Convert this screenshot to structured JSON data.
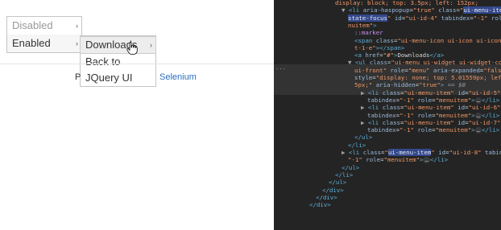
{
  "page": {
    "root_menu": {
      "items": [
        {
          "label": "Disabled",
          "state": "disabled"
        },
        {
          "label": "Enabled",
          "state": "active"
        }
      ]
    },
    "sub_menu": {
      "items": [
        {
          "label": "Downloads",
          "state": "focused"
        },
        {
          "label": "Back to"
        },
        {
          "label": "JQuery UI"
        }
      ]
    },
    "footer_fragment": "P",
    "footer_link": "Selenium"
  },
  "devtools": {
    "lines": [
      {
        "indent": 0,
        "html": "<span class='av'>display: block; top: 3.5px; left: 152px;</span>"
      },
      {
        "indent": 1,
        "html": "<span class='tri'>▼</span> <span class='tag'>&lt;li</span> <span class='an'>aria-haspopup</span>=<span class='av'>\"true\"</span> <span class='an'>class</span>=<span class='av'>\"</span><span class='hl'>ui-menu-item ui-</span>"
      },
      {
        "indent": 2,
        "html": "<span class='hl'>state-focus</span><span class='av'>\"</span> <span class='an'>id</span>=<span class='av'>\"ui-id-4\"</span> <span class='an'>tabindex</span>=<span class='av'>\"-1\"</span> <span class='an'>role</span>=<span class='av'>\"me</span>"
      },
      {
        "indent": 2,
        "html": "<span class='av'>nuitem\"</span><span class='tag'>&gt;</span>"
      },
      {
        "indent": 3,
        "html": "<span class='pseudo'>::marker</span>"
      },
      {
        "indent": 3,
        "html": "<span class='tag'>&lt;span</span> <span class='an'>class</span>=<span class='av'>\"ui-menu-icon ui-icon ui-icon-cara</span>"
      },
      {
        "indent": 3,
        "html": "<span class='av'>t-1-e\"</span><span class='tag'>&gt;&lt;/span&gt;</span>"
      },
      {
        "indent": 3,
        "html": "<span class='tag'>&lt;a</span> <span class='an'>href</span>=<span class='av'>\"#\"</span><span class='tag'>&gt;</span><span class='txt'>Downloads</span><span class='tag'>&lt;/a&gt;</span>"
      },
      {
        "indent": 2,
        "html": "<span class='tri'>▼</span> <span class='tag'>&lt;ul</span> <span class='an'>class</span>=<span class='av'>\"ui-menu ui-widget ui-widget-content</span>"
      },
      {
        "indent": 3,
        "html": "<span class='av'>ui-front\"</span> <span class='an'>role</span>=<span class='av'>\"menu\"</span> <span class='an'>aria-expanded</span>=<span class='av'>\"false\"</span>"
      },
      {
        "indent": 3,
        "html": "<span class='an'>style</span>=<span class='av'>\"display: none; top: 5.01559px; left: 14</span>"
      },
      {
        "indent": 3,
        "html": "<span class='av'>5px;\"</span> <span class='an'>aria-hidden</span>=<span class='av'>\"true\"</span><span class='tag'>&gt;</span> <span class='eqvar'>== $0</span>"
      },
      {
        "indent": 4,
        "html": "<span class='tri'>▶</span> <span class='tag'>&lt;li</span> <span class='an'>class</span>=<span class='av'>\"ui-menu-item\"</span> <span class='an'>id</span>=<span class='av'>\"ui-id-5\"</span>"
      },
      {
        "indent": 5,
        "html": "<span class='an'>tabindex</span>=<span class='av'>\"-1\"</span> <span class='an'>role</span>=<span class='av'>\"menuitem\"</span><span class='tag'>&gt;</span><span class='pill'>…</span><span class='tag'>&lt;/li&gt;</span>"
      },
      {
        "indent": 4,
        "html": "<span class='tri'>▶</span> <span class='tag'>&lt;li</span> <span class='an'>class</span>=<span class='av'>\"ui-menu-item\"</span> <span class='an'>id</span>=<span class='av'>\"ui-id-6\"</span>"
      },
      {
        "indent": 5,
        "html": "<span class='an'>tabindex</span>=<span class='av'>\"-1\"</span> <span class='an'>role</span>=<span class='av'>\"menuitem\"</span><span class='tag'>&gt;</span><span class='pill'>…</span><span class='tag'>&lt;/li&gt;</span>"
      },
      {
        "indent": 4,
        "html": "<span class='tri'>▶</span> <span class='tag'>&lt;li</span> <span class='an'>class</span>=<span class='av'>\"ui-menu-item\"</span> <span class='an'>id</span>=<span class='av'>\"ui-id-7\"</span>"
      },
      {
        "indent": 5,
        "html": "<span class='an'>tabindex</span>=<span class='av'>\"-1\"</span> <span class='an'>role</span>=<span class='av'>\"menuitem\"</span><span class='tag'>&gt;</span><span class='pill'>…</span><span class='tag'>&lt;/li&gt;</span>"
      },
      {
        "indent": 3,
        "html": "<span class='tag'>&lt;/ul&gt;</span>"
      },
      {
        "indent": 2,
        "html": "<span class='tag'>&lt;/li&gt;</span>"
      },
      {
        "indent": 1,
        "html": "<span class='tri'>▶</span> <span class='tag'>&lt;li</span> <span class='an'>class</span>=<span class='av'>\"</span><span class='hl'>ui-menu-item</span><span class='av'>\"</span> <span class='an'>id</span>=<span class='av'>\"ui-id-8\"</span> <span class='an'>tabindex</span>="
      },
      {
        "indent": 2,
        "html": "<span class='av'>\"-1\"</span> <span class='an'>role</span>=<span class='av'>\"menuitem\"</span><span class='tag'>&gt;</span><span class='pill'>…</span><span class='tag'>&lt;/li&gt;</span>"
      },
      {
        "indent": 1,
        "html": "<span class='tag'>&lt;/ul&gt;</span>"
      },
      {
        "indent": 0,
        "html": "<span class='tag'>&lt;/li&gt;</span>"
      },
      {
        "indent": -1,
        "html": "<span class='tag'>&lt;/ul&gt;</span>"
      },
      {
        "indent": -2,
        "html": "<span class='tag'>&lt;/div&gt;</span>"
      },
      {
        "indent": -3,
        "html": "<span class='tag'>&lt;/div&gt;</span>"
      },
      {
        "indent": -4,
        "html": "<span class='tag'>&lt;/div&gt;</span>"
      }
    ],
    "ellipsis_label": "..."
  },
  "colors": {
    "devtools_bg": "#242424",
    "selected_row": "#333333",
    "highlight": "#33488a",
    "link": "#2a6ebb"
  }
}
